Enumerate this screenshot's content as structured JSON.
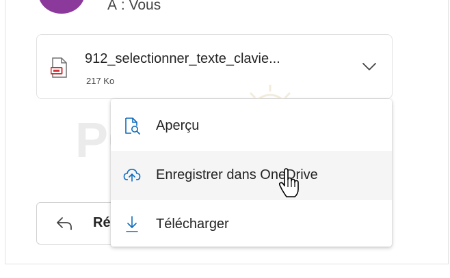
{
  "header": {
    "recipient_text": "À : Vous"
  },
  "attachment": {
    "file_name": "912_selectionner_texte_clavie...",
    "file_size": "217 Ko",
    "icon": "pdf-file-icon",
    "accent_color": "#d13438"
  },
  "context_menu": {
    "items": [
      {
        "label": "Aperçu",
        "icon": "preview-icon"
      },
      {
        "label": "Enregistrer dans OneDrive",
        "icon": "cloud-upload-icon"
      },
      {
        "label": "Télécharger",
        "icon": "download-icon"
      }
    ]
  },
  "reply": {
    "label": "Ré"
  },
  "watermark": {
    "text": "PC ASTUCES"
  },
  "colors": {
    "icon_blue": "#0f6cbd",
    "avatar": "#8b3a9c",
    "hover_bg": "#f5f5f5"
  }
}
